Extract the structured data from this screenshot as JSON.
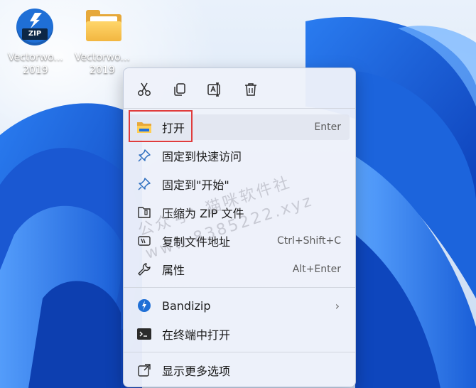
{
  "desktop": {
    "icons": [
      {
        "label_line1": "Vectorwo...",
        "label_line2": "2019",
        "badge": "ZIP",
        "icon": "bandizip-archive-icon"
      },
      {
        "label_line1": "Vectorwo...",
        "label_line2": "2019",
        "icon": "folder-icon"
      }
    ]
  },
  "context_menu": {
    "toolbar": [
      {
        "name": "cut",
        "icon": "scissors-icon"
      },
      {
        "name": "copy",
        "icon": "copy-icon"
      },
      {
        "name": "rename",
        "icon": "rename-icon"
      },
      {
        "name": "delete",
        "icon": "trash-icon"
      }
    ],
    "items": [
      {
        "label": "打开",
        "shortcut": "Enter",
        "icon": "folder-open-icon"
      },
      {
        "label": "固定到快速访问",
        "shortcut": "",
        "icon": "pin-icon"
      },
      {
        "label": "固定到\"开始\"",
        "shortcut": "",
        "icon": "pin-icon"
      },
      {
        "label": "压缩为 ZIP 文件",
        "shortcut": "",
        "icon": "zip-folder-icon"
      },
      {
        "label": "复制文件地址",
        "shortcut": "Ctrl+Shift+C",
        "icon": "path-copy-icon"
      },
      {
        "label": "属性",
        "shortcut": "Alt+Enter",
        "icon": "wrench-icon"
      },
      {
        "label": "Bandizip",
        "shortcut": "",
        "icon": "bandizip-icon"
      },
      {
        "label": "在终端中打开",
        "shortcut": "",
        "icon": "terminal-icon"
      },
      {
        "label": "显示更多选项",
        "shortcut": "",
        "icon": "more-options-icon"
      }
    ]
  },
  "watermark": {
    "line1": "公众号：猫咪软件社",
    "line2": "www.8385222.xyz"
  },
  "colors": {
    "highlight_box": "#e03c3c",
    "wallpaper_blue": "#1f6fe0",
    "menu_bg": "#eef1fa"
  }
}
